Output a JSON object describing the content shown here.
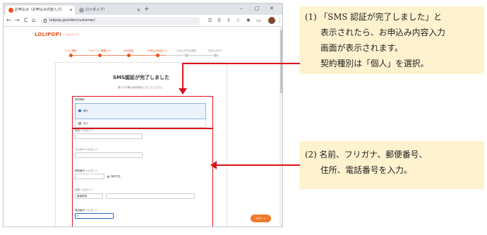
{
  "browser": {
    "tabs": [
      {
        "label": "お申込み（お申込み内容入力）"
      },
      {
        "label": "ロリポップ！"
      }
    ],
    "new_tab": "+",
    "window_controls": [
      "–",
      "□",
      "✕"
    ],
    "url": "lolipop.jp/order/customer/",
    "nav": {
      "back": "←",
      "forward": "→",
      "reload": "C",
      "home": "⌂"
    }
  },
  "page": {
    "logo": "LOLIPOP!",
    "logo_sub": "レンタルサーバー",
    "steps": [
      {
        "label": "プラン選択",
        "state": "done"
      },
      {
        "label": "アカウント情報入力",
        "state": "done"
      },
      {
        "label": "SMS認証",
        "state": "done"
      },
      {
        "label": "お申込み内容入力",
        "state": "current"
      },
      {
        "label": "お申込み内容確認",
        "state": "todo"
      },
      {
        "label": "お申込み完了",
        "state": "todo"
      }
    ],
    "card_title": "SMS認証が完了しました",
    "card_subtitle": "続いてお申込み内容を入力してください。",
    "contract_type": {
      "label": "契約種別",
      "options": [
        "個人",
        "法人"
      ],
      "selected": "個人"
    },
    "fields": {
      "name": {
        "label": "名前",
        "hint": "※必須入力",
        "value": ""
      },
      "furigana": {
        "label": "フリガナ",
        "hint": "※必須入力",
        "value": ""
      },
      "postal": {
        "label": "郵便番号",
        "hint": "※必須入力",
        "checkbox": "海外在住",
        "value": ""
      },
      "address": {
        "label": "住所",
        "hint": "※必須入力",
        "prefecture": "都道府県",
        "value": ""
      },
      "phone": {
        "label": "電話番号",
        "hint": "※必須入力",
        "value": "0"
      }
    },
    "support_button": "サポート"
  },
  "annotations": {
    "callout1": [
      "(1) 「SMS 認証が完了しました」と",
      "表示されたら、お申込み内容入力",
      "画面が表示されます。",
      "契約種別は「個人」を選択。"
    ],
    "callout2": [
      "(2) 名前、フリガナ、郵便番号、",
      "住所、電話番号を入力。"
    ],
    "highlight_color": "#d9151b",
    "callout_bg": "#fff2cf",
    "brand_color": "#e8521c"
  }
}
